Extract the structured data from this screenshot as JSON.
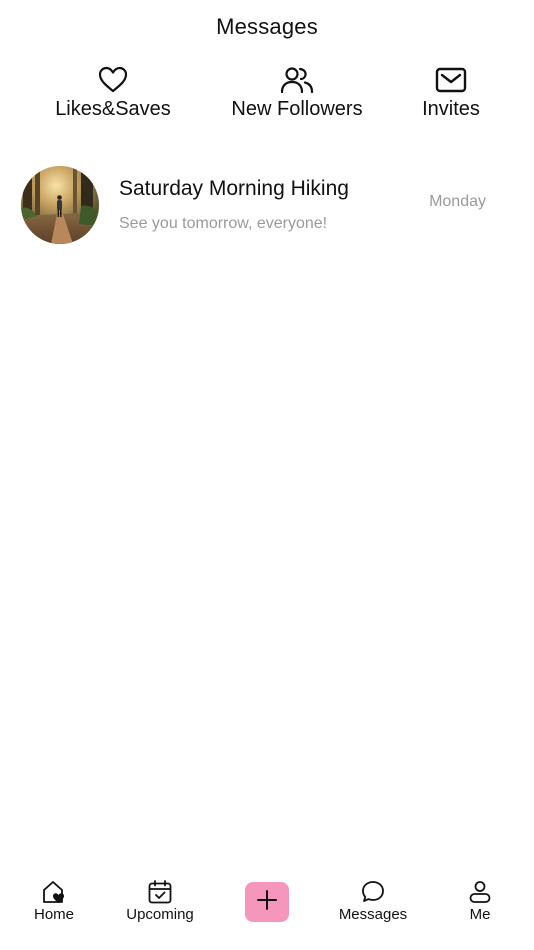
{
  "header": {
    "title": "Messages"
  },
  "categories": [
    {
      "label": "Likes&Saves",
      "icon": "heart-icon"
    },
    {
      "label": "New Followers",
      "icon": "users-icon"
    },
    {
      "label": "Invites",
      "icon": "envelope-icon"
    }
  ],
  "conversations": [
    {
      "title": "Saturday Morning Hiking",
      "preview": "See you tomorrow, everyone!",
      "time": "Monday",
      "avatar": "forest-trail-photo"
    }
  ],
  "tabbar": {
    "accent": "#f597bd",
    "tabs": [
      {
        "label": "Home",
        "icon": "home-heart-icon"
      },
      {
        "label": "Upcoming",
        "icon": "calendar-check-icon"
      },
      {
        "label": "Messages",
        "icon": "chat-bubble-icon"
      },
      {
        "label": "Me",
        "icon": "person-icon"
      }
    ],
    "create_icon": "plus-icon"
  }
}
